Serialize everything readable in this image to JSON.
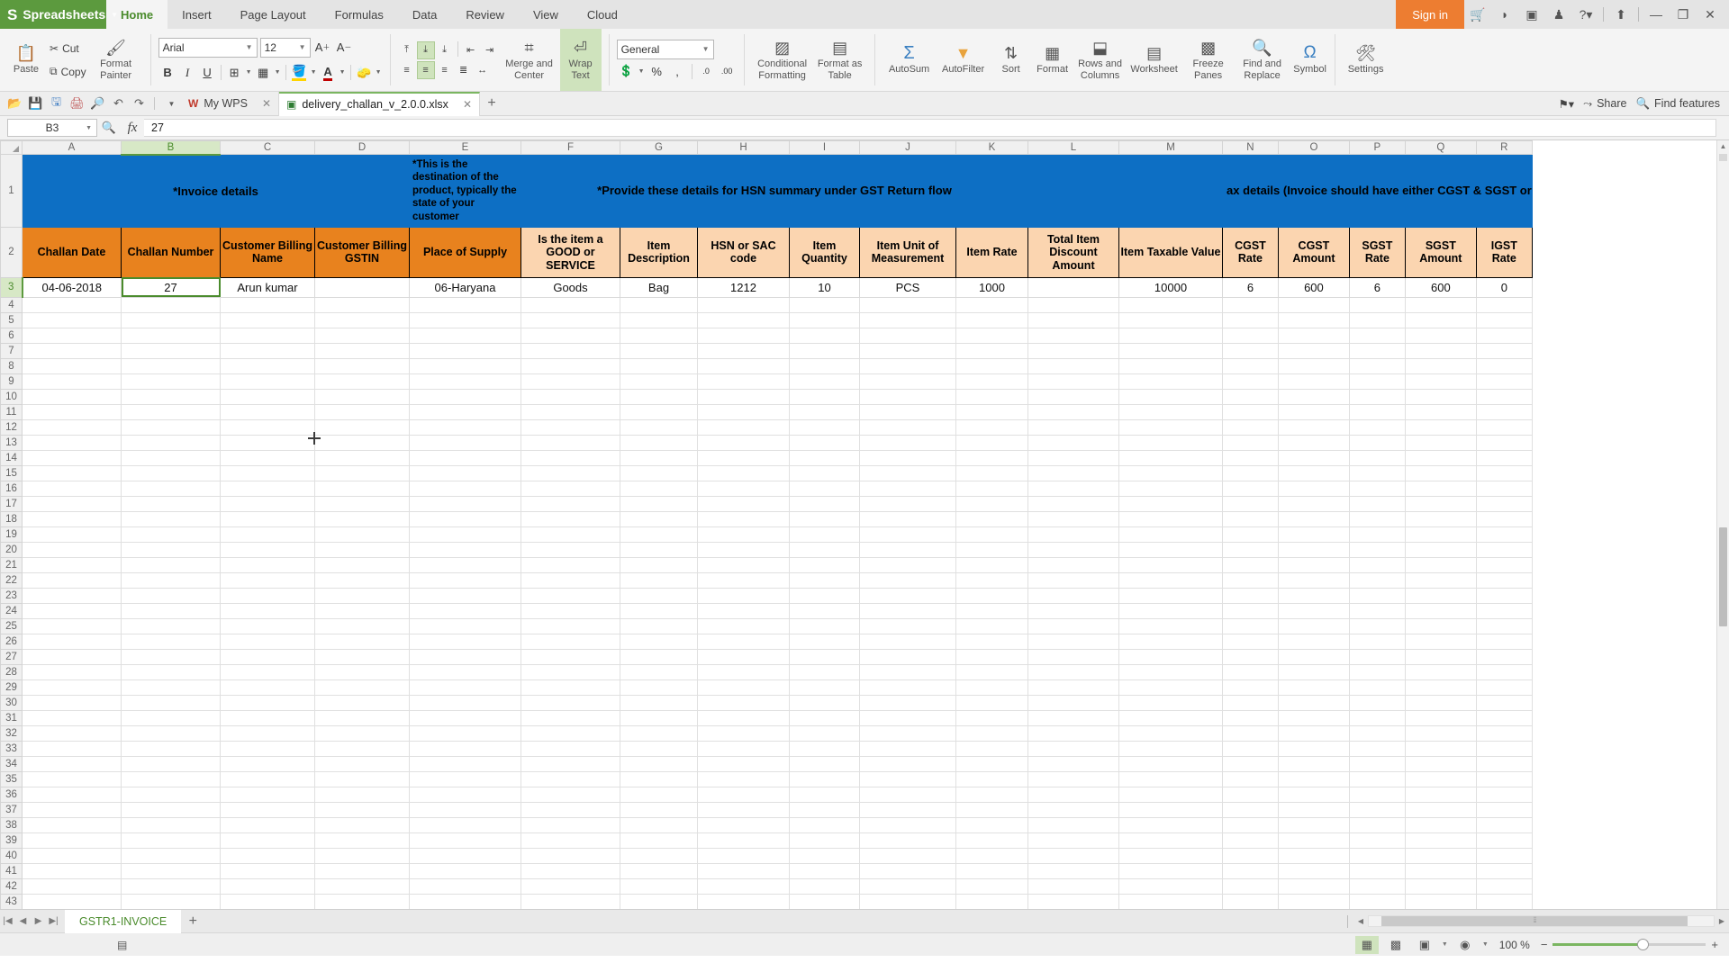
{
  "app": {
    "name": "Spreadsheets",
    "logo_glyph": "S",
    "menu_tabs": [
      "Home",
      "Insert",
      "Page Layout",
      "Formulas",
      "Data",
      "Review",
      "View",
      "Cloud"
    ],
    "active_menu_tab": "Home",
    "sign_in_label": "Sign in",
    "titlebar_icons": [
      "cart-icon",
      "drop-icon",
      "app-icon",
      "shirt-icon",
      "help-icon",
      "upload-icon",
      "minimize-icon",
      "restore-icon",
      "close-icon"
    ]
  },
  "ribbon": {
    "clipboard": {
      "paste_label": "Paste",
      "cut_label": "Cut",
      "copy_label": "Copy",
      "format_painter_label": "Format Painter"
    },
    "font": {
      "family_value": "Arial",
      "size_value": "12",
      "grow_label": "A",
      "shrink_label": "A",
      "bold_label": "B",
      "italic_label": "I",
      "underline_label": "U",
      "border_label": "borders-icon",
      "fill_label": "fill-color-icon",
      "font_color_label": "font-color-icon",
      "clear_label": "clear-format-icon"
    },
    "alignment": {
      "merge_label": "Merge and Center",
      "wrap_label": "Wrap Text"
    },
    "number": {
      "format_value": "General",
      "percent_label": "%",
      "comma_label": ",",
      "inc_dec_label": ".0",
      "dec_dec_label": ".00"
    },
    "styles": {
      "conditional_formatting_label": "Conditional Formatting",
      "format_as_table_label": "Format as Table"
    },
    "editing": [
      {
        "label": "AutoSum",
        "icon": "sigma-icon"
      },
      {
        "label": "AutoFilter",
        "icon": "funnel-icon"
      },
      {
        "label": "Sort",
        "icon": "sort-az-icon"
      },
      {
        "label": "Format",
        "icon": "table-format-icon"
      },
      {
        "label": "Rows and Columns",
        "icon": "rows-columns-icon"
      },
      {
        "label": "Worksheet",
        "icon": "worksheet-icon"
      },
      {
        "label": "Freeze Panes",
        "icon": "freeze-panes-icon"
      },
      {
        "label": "Find and Replace",
        "icon": "find-replace-icon"
      },
      {
        "label": "Symbol",
        "icon": "omega-icon"
      },
      {
        "label": "Settings",
        "icon": "settings-icon"
      }
    ]
  },
  "quick_access": {
    "icons": [
      "open-folder-icon",
      "save-icon",
      "save-as-icon",
      "print-icon",
      "print-preview-icon",
      "undo-icon",
      "redo-icon",
      "customize-caret-icon"
    ],
    "doc_tabs": [
      {
        "label": "My WPS",
        "icon": "wps-icon",
        "active": false
      },
      {
        "label": "delivery_challan_v_2.0.0.xlsx",
        "icon": "xlsx-icon",
        "active": true
      }
    ],
    "new_tab_label": "+",
    "right_items": [
      {
        "label": "",
        "icon": "collab-icon"
      },
      {
        "label": "Share",
        "icon": "share-icon"
      },
      {
        "label": "Find features",
        "icon": "search-icon"
      }
    ]
  },
  "formula_bar": {
    "name_box": "B3",
    "formula_value": "27",
    "fx_label": "fx",
    "insert_function_icon": "insert-function-icon"
  },
  "sheet": {
    "columns": [
      "A",
      "B",
      "C",
      "D",
      "E",
      "F",
      "G",
      "H",
      "I",
      "J",
      "K",
      "L",
      "M",
      "N",
      "O",
      "P",
      "Q",
      "R"
    ],
    "selected_column": "B",
    "selected_row": 3,
    "selected_cell": "B3",
    "row_numbers": [
      1,
      2,
      3,
      4,
      5,
      6,
      7,
      8,
      9,
      10,
      11,
      12,
      13,
      14,
      15,
      16,
      17,
      18,
      19,
      20,
      21,
      22,
      23,
      24,
      25,
      26,
      27,
      28,
      29,
      30,
      31,
      32,
      33,
      34,
      35,
      36,
      37,
      38,
      39,
      40,
      41,
      42,
      43
    ],
    "banner_row": {
      "invoice_details": "*Invoice details",
      "destination_note": "*This is the destination of the product, typically the state of your customer",
      "hsn_summary": "*Provide these details for HSN summary under GST Return flow",
      "blank_block": "",
      "tax_details": "ax details (Invoice should have either CGST & SGST or"
    },
    "headers": [
      "Challan Date",
      "Challan Number",
      "Customer Billing Name",
      "Customer Billing GSTIN",
      "Place of Supply",
      "Is the item a GOOD or SERVICE",
      "Item Description",
      "HSN or SAC code",
      "Item Quantity",
      "Item Unit of Measurement",
      "Item Rate",
      "Total Item Discount Amount",
      "Item Taxable Value",
      "CGST Rate",
      "CGST Amount",
      "SGST Rate",
      "SGST Amount",
      "IGST Rate"
    ],
    "data_row": [
      "04-06-2018",
      "27",
      "Arun kumar",
      "",
      "06-Haryana",
      "Goods",
      "Bag",
      "1212",
      "10",
      "PCS",
      "1000",
      "",
      "10000",
      "6",
      "600",
      "6",
      "600",
      "0"
    ]
  },
  "sheet_tabs": {
    "tabs": [
      "GSTR1-INVOICE"
    ],
    "active": "GSTR1-INVOICE",
    "add_label": "+",
    "nav_first": "first-sheet-icon",
    "nav_prev": "prev-sheet-icon",
    "nav_next": "next-sheet-icon",
    "nav_last": "last-sheet-icon"
  },
  "status_bar": {
    "zoom_value": "100 %",
    "view_buttons": [
      "normal-view-icon",
      "page-break-view-icon",
      "reading-layout-icon",
      "eye-protection-icon"
    ],
    "active_view": "normal-view-icon",
    "zoom_out_label": "−",
    "zoom_in_label": "+"
  },
  "colors": {
    "brand_green": "#5c9a3e",
    "accent_orange": "#ed7d31",
    "banner_blue": "#0d6fc4",
    "header_orange": "#e8821e",
    "header_peach": "#fbd5b0",
    "selection_green": "#4a8b2c"
  }
}
